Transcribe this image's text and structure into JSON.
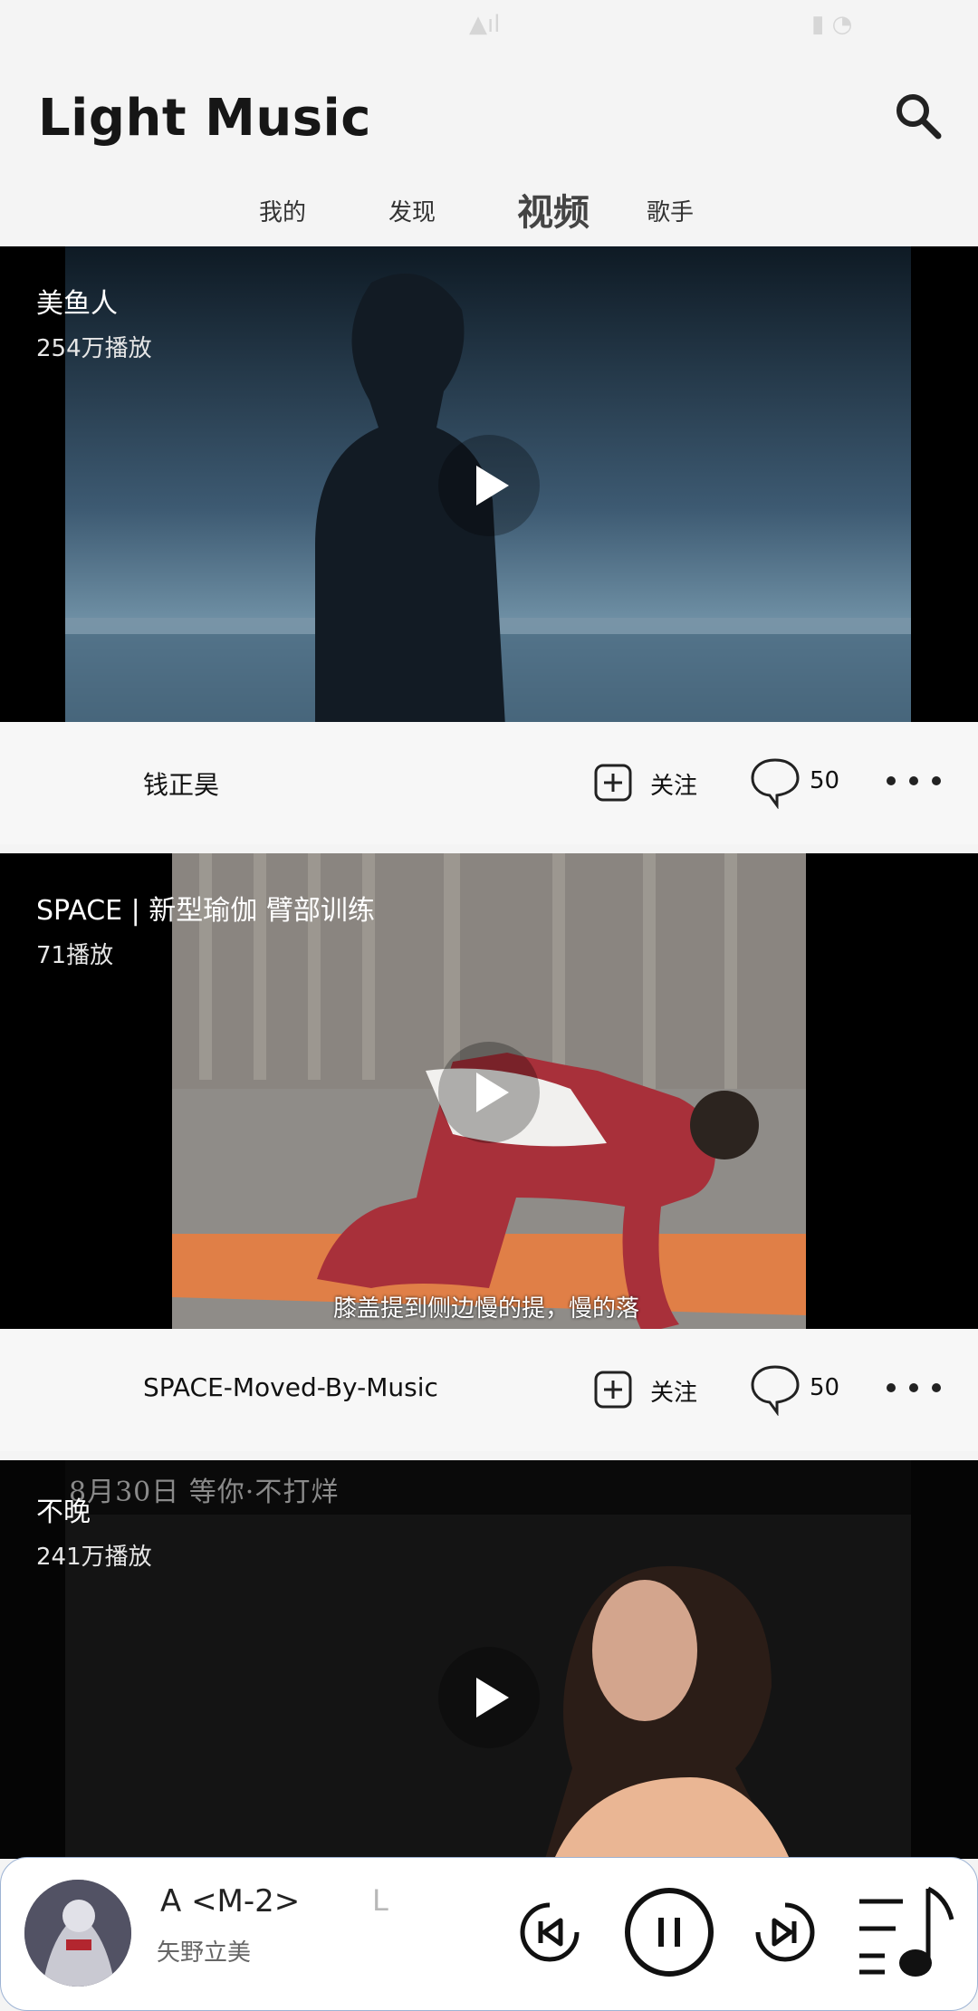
{
  "app": {
    "title": "Light Music"
  },
  "tabs": [
    {
      "label": "我的",
      "active": false
    },
    {
      "label": "发现",
      "active": false
    },
    {
      "label": "视频",
      "active": true
    },
    {
      "label": "歌手",
      "active": false
    }
  ],
  "videos": [
    {
      "title": "美鱼人",
      "plays": "254万播放",
      "author": "钱正昊",
      "follow_label": "关注",
      "comments": "50",
      "subtitle": ""
    },
    {
      "title": "SPACE | 新型瑜伽 臂部训练",
      "plays": "71播放",
      "author": "SPACE-Moved-By-Music",
      "follow_label": "关注",
      "comments": "50",
      "subtitle": "膝盖提到侧边慢的提，慢的落"
    },
    {
      "title": "不晚",
      "plays": "241万播放",
      "promo": "8月30日 等你·不打烊"
    }
  ],
  "player": {
    "title": "A <M-2>",
    "ghost_text": "L",
    "artist": "矢野立美",
    "state": "playing"
  },
  "icons": {
    "search": "search-icon",
    "follow": "plus-square-icon",
    "comment": "speech-bubble-icon",
    "more": "more-dots-icon",
    "play": "play-icon",
    "prev": "skip-previous-icon",
    "pause": "pause-icon",
    "next": "skip-next-icon",
    "playlist": "playlist-music-icon"
  },
  "colors": {
    "accent_border": "#9db3d4",
    "background": "#f4f4f4"
  }
}
